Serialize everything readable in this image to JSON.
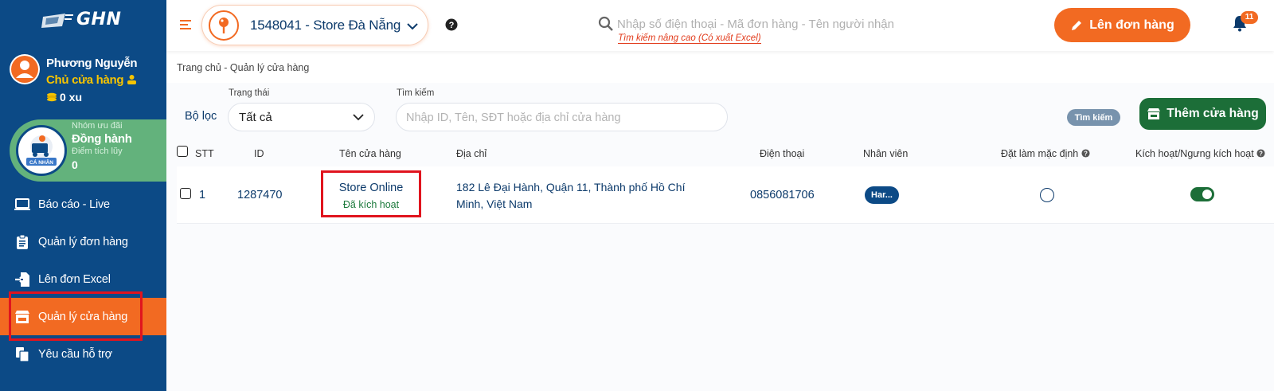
{
  "brand": {
    "logo_text": "GHN"
  },
  "user": {
    "name": "Phương Nguyễn",
    "role": "Chủ cửa hàng",
    "coins": "0 xu"
  },
  "membership": {
    "badge_text": "CÁ NHÂN",
    "group_label": "Nhóm ưu đãi",
    "group_name": "Đồng hành",
    "points_label": "Điểm tích lũy",
    "points": "0"
  },
  "sidebar": {
    "items": [
      {
        "label": "Báo cáo - Live",
        "icon": "monitor-icon",
        "active": false
      },
      {
        "label": "Quản lý đơn hàng",
        "icon": "clipboard-icon",
        "active": false
      },
      {
        "label": "Lên đơn Excel",
        "icon": "import-file-icon",
        "active": false
      },
      {
        "label": "Quản lý cửa hàng",
        "icon": "store-icon",
        "active": true
      },
      {
        "label": "Yêu cầu hỗ trợ",
        "icon": "copy-files-icon",
        "active": false
      }
    ]
  },
  "topbar": {
    "store_selector": "1548041 - Store Đà Nẵng",
    "search_placeholder": "Nhập số điện thoại - Mã đơn hàng - Tên người nhận",
    "advanced_search": "Tìm kiếm nâng cao (Có xuất Excel)",
    "create_order_label": "Lên đơn hàng",
    "notification_count": "11"
  },
  "breadcrumb": "Trang chủ - Quản lý cửa hàng",
  "filters": {
    "label": "Bộ lọc",
    "status_label": "Trạng thái",
    "status_value": "Tất cả",
    "search_label": "Tìm kiếm",
    "search_placeholder": "Nhập ID, Tên, SĐT hoặc địa chỉ cửa hàng",
    "search_button": "Tìm kiếm",
    "add_store_button": "Thêm cửa hàng"
  },
  "table": {
    "columns": [
      "STT",
      "ID",
      "Tên cửa hàng",
      "Địa chỉ",
      "Điện thoại",
      "Nhân viên",
      "Đặt làm mặc định",
      "Kích hoạt/Ngưng kích hoạt"
    ],
    "rows": [
      {
        "stt": "1",
        "id": "1287470",
        "store_name": "Store Online",
        "store_status": "Đã kích hoạt",
        "address": "182 Lê Đại Hành, Quận 11, Thành phố Hồ Chí Minh, Việt Nam",
        "phone": "0856081706",
        "staff": "Har...",
        "is_default": false,
        "active": true
      }
    ]
  },
  "colors": {
    "sidebar_bg": "#0c4a86",
    "accent_orange": "#f26a22",
    "accent_green": "#1c6e38",
    "member_green": "#63b27c",
    "highlight_red": "#e0141e",
    "text_navy": "#0c3a6b"
  }
}
